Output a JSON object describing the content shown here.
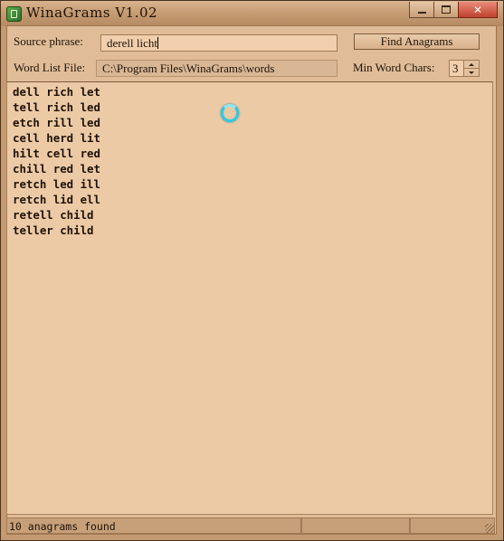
{
  "window": {
    "title": "WinaGrams  V1.02"
  },
  "caption_buttons": {
    "minimize_icon": "minimize-icon",
    "maximize_icon": "maximize-icon",
    "close_icon": "close-icon",
    "close_glyph": "✕"
  },
  "form": {
    "source_label": "Source phrase:",
    "source_value": "derell licht",
    "find_button": "Find Anagrams",
    "wordlist_label": "Word List File:",
    "wordlist_value": "C:\\Program Files\\WinaGrams\\words",
    "minchars_label": "Min Word Chars:",
    "minchars_value": "3"
  },
  "results": [
    "dell rich let",
    "tell rich led",
    "etch rill led",
    "cell herd lit",
    "hilt cell red",
    "chill red let",
    "retch led ill",
    "retch lid ell",
    "retell child",
    "teller child"
  ],
  "status": {
    "text": "10 anagrams found"
  },
  "colors": {
    "panel": "#e0bd98",
    "results_bg": "#edcaa6",
    "frame": "#c49a72",
    "busy_indicator": "#2ec9e2"
  }
}
